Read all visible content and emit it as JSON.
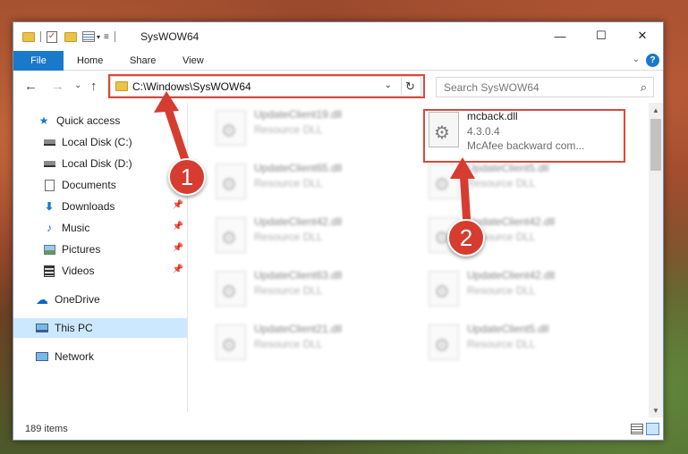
{
  "window": {
    "title": "SysWOW64",
    "minimize": "—",
    "maximize": "☐",
    "close": "✕"
  },
  "ribbon": {
    "tabs": [
      "File",
      "Home",
      "Share",
      "View"
    ],
    "expand": "⌄",
    "help": "?"
  },
  "nav": {
    "back": "←",
    "forward": "→",
    "recent": "⌄",
    "up": "↑",
    "address": "C:\\Windows\\SysWOW64",
    "address_dropdown": "⌄",
    "refresh": "↻",
    "search_placeholder": "Search SysWOW64",
    "search_icon": "⌕"
  },
  "sidebar": {
    "items": [
      {
        "label": "Quick access",
        "icon": "star-icon"
      },
      {
        "label": "Local Disk (C:)",
        "icon": "drive-icon"
      },
      {
        "label": "Local Disk (D:)",
        "icon": "drive-icon"
      },
      {
        "label": "Documents",
        "icon": "documents-icon"
      },
      {
        "label": "Downloads",
        "icon": "download-icon"
      },
      {
        "label": "Music",
        "icon": "music-icon"
      },
      {
        "label": "Pictures",
        "icon": "pictures-icon"
      },
      {
        "label": "Videos",
        "icon": "videos-icon"
      },
      {
        "label": "OneDrive",
        "icon": "cloud-icon"
      },
      {
        "label": "This PC",
        "icon": "computer-icon"
      },
      {
        "label": "Network",
        "icon": "network-icon"
      }
    ]
  },
  "files": [
    {
      "name": "UpdateClient19.dll",
      "type": "Resource DLL"
    },
    {
      "name": "mcback.dll",
      "version": "4.3.0.4",
      "description": "McAfee backward com..."
    },
    {
      "name": "UpdateClient65.dll",
      "type": "Resource DLL"
    },
    {
      "name": "UpdateClient5.dll",
      "type": "Resource DLL"
    },
    {
      "name": "UpdateClient42.dll",
      "type": "Resource DLL"
    },
    {
      "name": "UpdateClient42.dll",
      "type": "Resource DLL"
    },
    {
      "name": "UpdateClient63.dll",
      "type": "Resource DLL"
    },
    {
      "name": "UpdateClient42.dll",
      "type": "Resource DLL"
    },
    {
      "name": "UpdateClient21.dll",
      "type": "Resource DLL"
    },
    {
      "name": "UpdateClient5.dll",
      "type": "Resource DLL"
    }
  ],
  "status": {
    "item_count": "189 items"
  },
  "annotations": {
    "step1": "1",
    "step2": "2",
    "color": "#d63c30"
  },
  "colors": {
    "accent": "#1979ca",
    "highlight_box": "#d9483b",
    "selected_bg": "#cce8ff"
  }
}
